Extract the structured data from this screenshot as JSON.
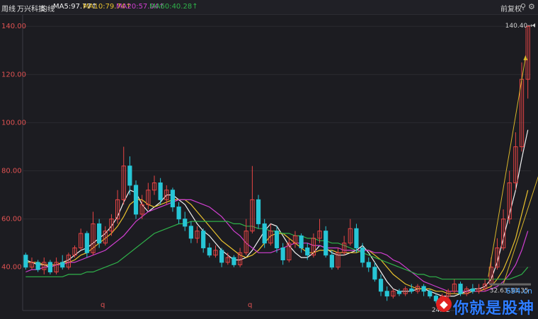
{
  "header": {
    "period": "周线",
    "stock_name": "万兴科技",
    "ma_label": "均线",
    "ma5": "MA5:97.77↑",
    "ma10": "MA10:79.74↑",
    "ma20": "MA20:57.04↑",
    "ma60": "MA60:40.28↑",
    "adjust": "前复权",
    "icon_lock": "lock-icon",
    "icon_gear": "gear-icon",
    "icon_close": "close-icon"
  },
  "colors": {
    "up": "#e84545",
    "down": "#27c6d6",
    "ma5": "#f2f2f2",
    "ma10": "#e9c22e",
    "ma20": "#d13fd1",
    "ma60": "#2fb24a",
    "axis_text": "#e05252",
    "grid": "#2a2a30",
    "background": "#1c1c21"
  },
  "chart_data": {
    "type": "candlestick",
    "title": "",
    "xlabel": "",
    "ylabel": "",
    "ylim": [
      22,
      143
    ],
    "yticks": [
      {
        "value": 40,
        "label": "40.00"
      },
      {
        "value": 60,
        "label": "60.00"
      },
      {
        "value": 80,
        "label": "80.00"
      },
      {
        "value": 100,
        "label": "100.00"
      },
      {
        "value": 120,
        "label": "120.00"
      },
      {
        "value": 140,
        "label": "140.00"
      }
    ],
    "grid": true,
    "annotations": {
      "max_label": "140.40",
      "min_label": "24.52",
      "range_label": "32.63-33.35",
      "marker_q1": "q",
      "marker_q2": "q"
    },
    "series": [
      {
        "name": "MA5",
        "values": [
          43,
          42,
          41,
          41,
          40,
          41,
          42,
          43,
          45,
          47,
          48,
          50,
          52,
          54,
          57,
          61,
          67,
          72,
          71,
          66,
          63,
          65,
          67,
          70,
          70,
          68,
          66,
          62,
          58,
          55,
          53,
          50,
          47,
          45,
          43,
          43,
          44,
          47,
          51,
          55,
          58,
          57,
          53,
          49,
          46,
          44,
          44,
          46,
          49,
          48,
          46,
          45,
          45,
          46,
          47,
          49,
          46,
          42,
          38,
          34,
          31,
          30,
          30,
          30,
          31,
          31,
          30,
          29,
          28,
          28,
          28,
          29,
          30,
          31,
          31,
          32,
          35,
          42,
          52,
          62,
          72,
          85,
          97
        ]
      },
      {
        "name": "MA10",
        "values": [
          42,
          42,
          42,
          41,
          41,
          41,
          42,
          42,
          43,
          45,
          46,
          48,
          50,
          52,
          54,
          57,
          61,
          66,
          68,
          68,
          66,
          65,
          66,
          67,
          68,
          68,
          68,
          66,
          63,
          60,
          57,
          54,
          51,
          49,
          47,
          45,
          44,
          45,
          47,
          50,
          53,
          54,
          54,
          52,
          50,
          48,
          46,
          46,
          47,
          47,
          47,
          46,
          46,
          46,
          46,
          47,
          47,
          45,
          43,
          40,
          37,
          35,
          33,
          32,
          31,
          31,
          31,
          30,
          30,
          29,
          29,
          29,
          29,
          30,
          30,
          31,
          32,
          35,
          39,
          45,
          52,
          62,
          72
        ]
      },
      {
        "name": "MA20",
        "values": [
          38,
          39,
          39,
          40,
          40,
          41,
          41,
          42,
          42,
          43,
          44,
          45,
          46,
          47,
          49,
          51,
          53,
          56,
          59,
          61,
          63,
          64,
          65,
          66,
          67,
          68,
          68,
          68,
          67,
          66,
          65,
          63,
          61,
          58,
          55,
          53,
          50,
          48,
          46,
          46,
          46,
          47,
          48,
          49,
          50,
          50,
          50,
          49,
          49,
          48,
          48,
          48,
          47,
          47,
          47,
          47,
          47,
          46,
          46,
          45,
          43,
          42,
          40,
          38,
          36,
          34,
          33,
          32,
          31,
          30,
          30,
          30,
          30,
          30,
          30,
          30,
          31,
          32,
          34,
          37,
          41,
          47,
          55
        ]
      },
      {
        "name": "MA60",
        "values": [
          36,
          36,
          36,
          36,
          36,
          36,
          36,
          37,
          37,
          37,
          38,
          38,
          39,
          40,
          41,
          42,
          44,
          46,
          48,
          50,
          52,
          54,
          55,
          56,
          57,
          58,
          58,
          59,
          59,
          59,
          59,
          59,
          59,
          59,
          58,
          58,
          57,
          57,
          56,
          56,
          55,
          55,
          54,
          54,
          53,
          53,
          52,
          52,
          51,
          51,
          50,
          50,
          49,
          48,
          47,
          46,
          45,
          44,
          43,
          42,
          41,
          40,
          39,
          38,
          37,
          37,
          36,
          36,
          35,
          35,
          35,
          35,
          35,
          35,
          35,
          35,
          35,
          35,
          35,
          35,
          36,
          37,
          40
        ]
      }
    ],
    "candles": [
      [
        45,
        40,
        46,
        39
      ],
      [
        40,
        42,
        44,
        39
      ],
      [
        42,
        39,
        43,
        38
      ],
      [
        39,
        42,
        44,
        37
      ],
      [
        42,
        38,
        43,
        37
      ],
      [
        38,
        42,
        44,
        37
      ],
      [
        42,
        40,
        45,
        39
      ],
      [
        40,
        45,
        46,
        39
      ],
      [
        45,
        48,
        49,
        44
      ],
      [
        48,
        54,
        56,
        47
      ],
      [
        54,
        46,
        55,
        44
      ],
      [
        46,
        58,
        63,
        45
      ],
      [
        58,
        50,
        60,
        48
      ],
      [
        50,
        55,
        57,
        49
      ],
      [
        55,
        60,
        62,
        53
      ],
      [
        60,
        68,
        72,
        58
      ],
      [
        68,
        82,
        90,
        66
      ],
      [
        82,
        74,
        86,
        70
      ],
      [
        74,
        62,
        76,
        60
      ],
      [
        62,
        66,
        70,
        60
      ],
      [
        66,
        72,
        75,
        64
      ],
      [
        72,
        75,
        78,
        70
      ],
      [
        75,
        68,
        77,
        66
      ],
      [
        68,
        72,
        74,
        66
      ],
      [
        72,
        65,
        73,
        63
      ],
      [
        65,
        60,
        67,
        58
      ],
      [
        60,
        57,
        63,
        55
      ],
      [
        57,
        52,
        59,
        50
      ],
      [
        52,
        55,
        57,
        50
      ],
      [
        55,
        48,
        56,
        46
      ],
      [
        48,
        45,
        50,
        44
      ],
      [
        45,
        47,
        49,
        44
      ],
      [
        47,
        42,
        48,
        40
      ],
      [
        42,
        44,
        46,
        41
      ],
      [
        44,
        41,
        45,
        40
      ],
      [
        41,
        46,
        48,
        40
      ],
      [
        46,
        55,
        60,
        45
      ],
      [
        55,
        68,
        82,
        54
      ],
      [
        68,
        58,
        70,
        56
      ],
      [
        58,
        50,
        60,
        48
      ],
      [
        50,
        55,
        58,
        49
      ],
      [
        55,
        48,
        57,
        46
      ],
      [
        48,
        43,
        50,
        41
      ],
      [
        43,
        50,
        52,
        42
      ],
      [
        50,
        53,
        55,
        48
      ],
      [
        53,
        48,
        54,
        46
      ],
      [
        48,
        45,
        50,
        43
      ],
      [
        45,
        52,
        54,
        44
      ],
      [
        52,
        55,
        60,
        50
      ],
      [
        55,
        45,
        57,
        44
      ],
      [
        45,
        40,
        47,
        39
      ],
      [
        40,
        46,
        48,
        39
      ],
      [
        46,
        50,
        53,
        45
      ],
      [
        50,
        56,
        60,
        49
      ],
      [
        56,
        48,
        58,
        46
      ],
      [
        48,
        42,
        50,
        40
      ],
      [
        42,
        40,
        44,
        38
      ],
      [
        40,
        35,
        42,
        34
      ],
      [
        35,
        30,
        37,
        28
      ],
      [
        30,
        28,
        32,
        26
      ],
      [
        28,
        30,
        31,
        27
      ],
      [
        30,
        29,
        31,
        28
      ],
      [
        29,
        31,
        32,
        28
      ],
      [
        31,
        30,
        33,
        29
      ],
      [
        30,
        32,
        33,
        29
      ],
      [
        32,
        30,
        33,
        28
      ],
      [
        30,
        28,
        31,
        27
      ],
      [
        28,
        26,
        29,
        25
      ],
      [
        26,
        28,
        29,
        25
      ],
      [
        28,
        30,
        31,
        27
      ],
      [
        30,
        33,
        35,
        29
      ],
      [
        33,
        29,
        34,
        28
      ],
      [
        29,
        31,
        32,
        28
      ],
      [
        31,
        30,
        33,
        29
      ],
      [
        30,
        31,
        33,
        29
      ],
      [
        31,
        33,
        35,
        30
      ],
      [
        33,
        40,
        44,
        32
      ],
      [
        40,
        48,
        52,
        39
      ],
      [
        48,
        60,
        64,
        47
      ],
      [
        60,
        75,
        80,
        58
      ],
      [
        75,
        90,
        96,
        72
      ],
      [
        90,
        118,
        125,
        88
      ],
      [
        118,
        140,
        140.4,
        110
      ]
    ]
  }
}
